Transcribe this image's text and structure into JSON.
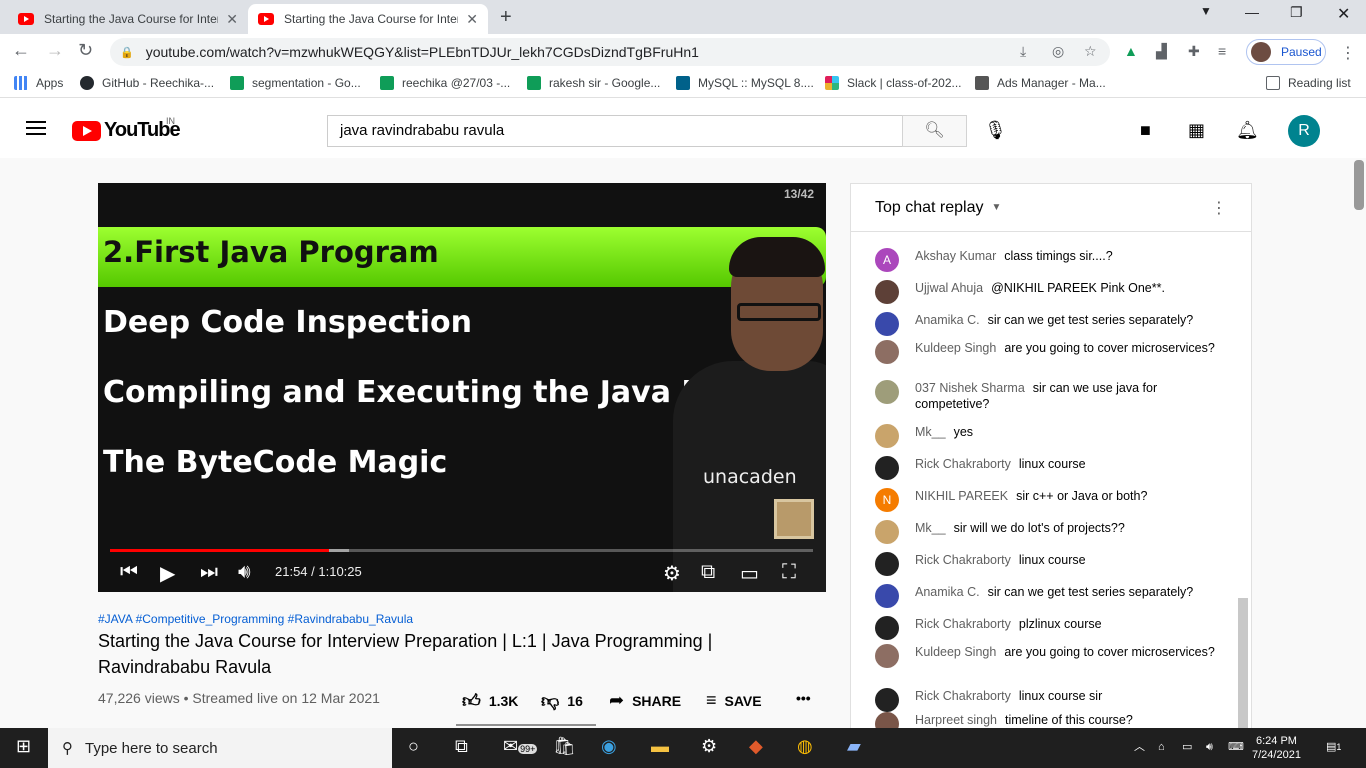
{
  "browser": {
    "tabs": [
      {
        "title": "Starting the Java Course for Inter",
        "active": false
      },
      {
        "title": "Starting the Java Course for Inter",
        "active": true
      }
    ],
    "url": "youtube.com/watch?v=mzwhukWEQGY&list=PLEbnTDJUr_lekh7CGDsDizndTgBFruHn1",
    "profile_status": "Paused",
    "reading_list": "Reading list",
    "bookmarks": [
      "Apps",
      "GitHub - Reechika-...",
      "segmentation - Go...",
      "reechika @27/03 -...",
      "rakesh sir - Google...",
      "MySQL :: MySQL 8....",
      "Slack | class-of-202...",
      "Ads Manager - Ma..."
    ]
  },
  "youtube": {
    "logo_text": "YouTube",
    "country": "IN",
    "search_value": "java ravindrababu ravula",
    "avatar_letter": "R"
  },
  "player": {
    "counter": "13/42",
    "slide_title": "2.First Java Program",
    "slide_lines": [
      "Deep Code Inspection",
      "Compiling and Executing the Java Prog",
      "The ByteCode Magic"
    ],
    "brand": "unacaden",
    "time": "21:54 / 1:10:25",
    "progress_fraction": 0.311
  },
  "video": {
    "tags": "#JAVA #Competitive_Programming #Ravindrababu_Ravula",
    "title": "Starting the Java Course for Interview Preparation | L:1 | Java Programming | Ravindrababu Ravula",
    "views": "47,226 views • Streamed live on 12 Mar 2021",
    "likes": "1.3K",
    "dislikes": "16",
    "share": "SHARE",
    "save": "SAVE"
  },
  "chat": {
    "header": "Top chat replay",
    "messages": [
      {
        "author": "Akshay Kumar",
        "text": "class timings sir....?",
        "avatar": "A",
        "color": "#ab47bc"
      },
      {
        "author": "Ujjwal Ahuja",
        "text": "@NIKHIL PAREEK Pink One**.",
        "avatar": "",
        "color": "#5d4037"
      },
      {
        "author": "Anamika C.",
        "text": "sir can we get test series separately?",
        "avatar": "",
        "color": "#3949ab"
      },
      {
        "author": "Kuldeep Singh",
        "text": "are you going to cover microservices?",
        "avatar": "",
        "color": "#8d6e63"
      },
      {
        "author": "037 Nishek Sharma",
        "text": "sir can we use java for competetive?",
        "avatar": "",
        "color": "#9e9d7a"
      },
      {
        "author": "Mk__",
        "text": "yes",
        "avatar": "",
        "color": "#c9a46b"
      },
      {
        "author": "Rick Chakraborty",
        "text": "linux course",
        "avatar": "",
        "color": "#222222"
      },
      {
        "author": "NIKHIL PAREEK",
        "text": "sir c++ or Java or both?",
        "avatar": "N",
        "color": "#f57c00"
      },
      {
        "author": "Mk__",
        "text": "sir will we do lot's of projects??",
        "avatar": "",
        "color": "#c9a46b"
      },
      {
        "author": "Rick Chakraborty",
        "text": "linux course",
        "avatar": "",
        "color": "#222222"
      },
      {
        "author": "Anamika C.",
        "text": "sir can we get test series separately?",
        "avatar": "",
        "color": "#3949ab"
      },
      {
        "author": "Rick Chakraborty",
        "text": "plzlinux course",
        "avatar": "",
        "color": "#222222"
      },
      {
        "author": "Kuldeep Singh",
        "text": "are you going to cover microservices?",
        "avatar": "",
        "color": "#8d6e63"
      },
      {
        "author": "Rick Chakraborty",
        "text": "linux course sir",
        "avatar": "",
        "color": "#222222"
      },
      {
        "author": "Harpreet singh",
        "text": "timeline of this course?",
        "avatar": "",
        "color": "#795548"
      }
    ]
  },
  "taskbar": {
    "search_placeholder": "Type here to search",
    "mail_badge": "99+",
    "time": "6:24 PM",
    "date": "7/24/2021",
    "notifications": "1"
  }
}
